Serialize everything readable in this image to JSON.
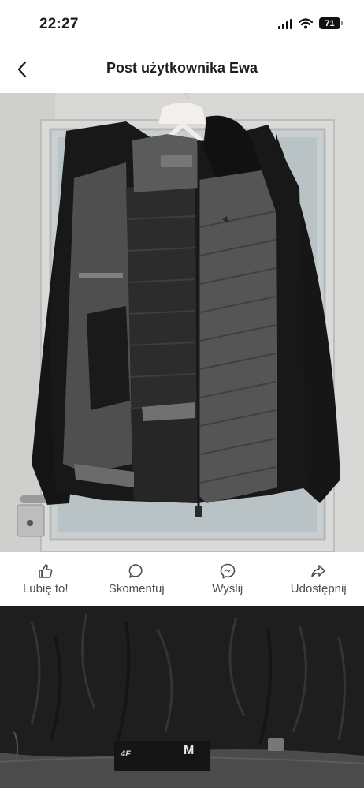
{
  "status_bar": {
    "time": "22:27",
    "battery": "71",
    "icons": [
      "signal-icon",
      "wifi-icon",
      "battery-icon"
    ]
  },
  "header": {
    "title": "Post użytkownika Ewa",
    "back_icon": "chevron-left-icon"
  },
  "actions": [
    {
      "label": "Lubię to!",
      "icon": "thumbs-up-icon"
    },
    {
      "label": "Skomentuj",
      "icon": "comment-icon"
    },
    {
      "label": "Wyślij",
      "icon": "messenger-icon"
    },
    {
      "label": "Udostępnij",
      "icon": "share-icon"
    }
  ],
  "photo_2": {
    "label_brand": "4F",
    "label_size": "M"
  },
  "colors": {
    "text_primary": "#1c1e21",
    "text_secondary": "#4b4f56",
    "jacket_black": "#141414",
    "jacket_grey": "#4a4b4a",
    "wall": "#d6d6d4"
  }
}
